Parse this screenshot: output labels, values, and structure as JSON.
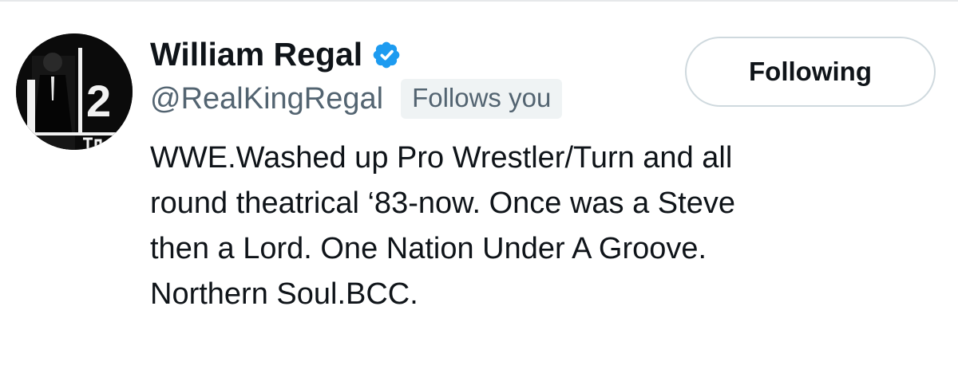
{
  "profile": {
    "display_name": "William Regal",
    "verified": true,
    "handle": "@RealKingRegal",
    "follows_you_label": "Follows you",
    "avatar_text": "2",
    "bio_lines": [
      "WWE.Washed up Pro Wrestler/Turn and all",
      "round theatrical ‘83-now. Once was a Steve",
      "then a Lord. One Nation Under A Groove.",
      "Northern Soul.BCC."
    ]
  },
  "actions": {
    "following_label": "Following"
  },
  "colors": {
    "text_primary": "#0f1419",
    "text_secondary": "#536471",
    "verified_blue": "#1d9bf0",
    "badge_bg": "#eff3f4",
    "button_border": "#cfd9de"
  },
  "icons": {
    "verified": "verified-badge-icon"
  }
}
